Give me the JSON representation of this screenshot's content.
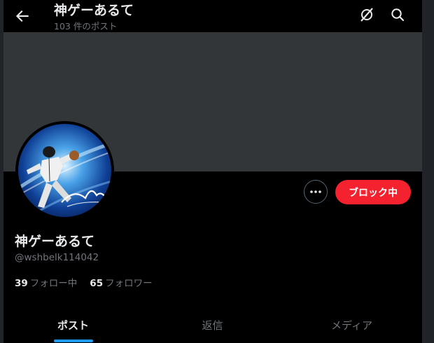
{
  "header": {
    "title": "神ゲーあるて",
    "post_count": "103 件のポスト"
  },
  "icons": {
    "back": "arrow-left-icon",
    "grok": "grok-icon",
    "search": "search-icon",
    "more": "more-horizontal-icon"
  },
  "profile": {
    "display_name": "神ゲーあるて",
    "handle": "@wshbelk114042",
    "block_button_label": "ブロック中",
    "following_count": "39",
    "following_label": "フォロー中",
    "followers_count": "65",
    "followers_label": "フォロワー"
  },
  "tabs": [
    {
      "label": "ポスト",
      "active": true
    },
    {
      "label": "返信",
      "active": false
    },
    {
      "label": "メディア",
      "active": false
    }
  ],
  "colors": {
    "background": "#000000",
    "outer_background": "#202327",
    "banner": "#333639",
    "block_button": "#f4212e",
    "accent": "#1d9bf0",
    "secondary_text": "#71767b",
    "primary_text": "#e7e9ea"
  }
}
